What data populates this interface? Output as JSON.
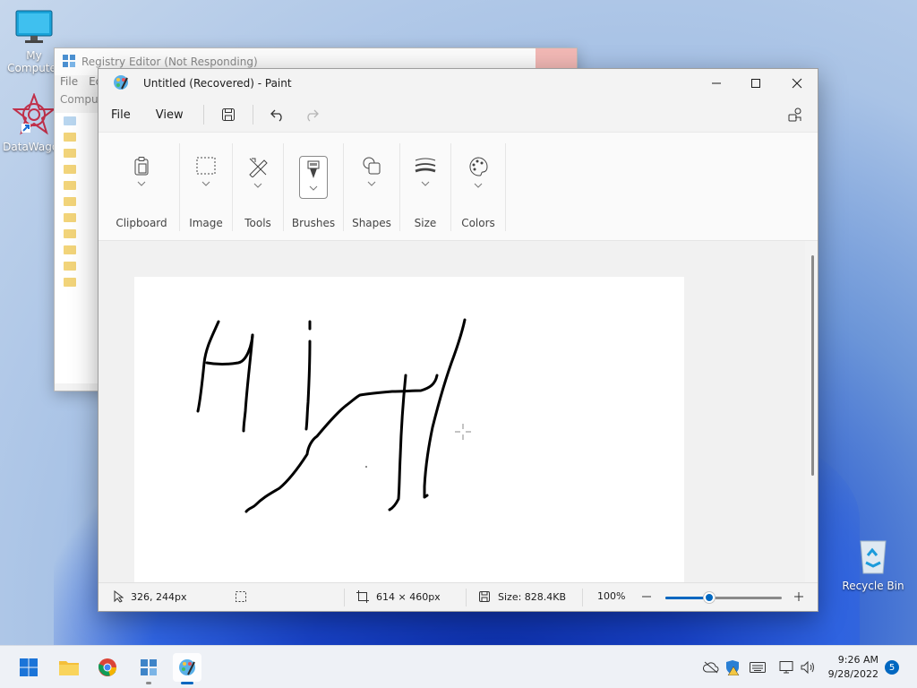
{
  "desktop": {
    "icons": [
      {
        "label": "My Computer",
        "name": "my-computer"
      },
      {
        "label": "DataWagon",
        "name": "datawagon"
      },
      {
        "label": "Recycle Bin",
        "name": "recycle-bin"
      }
    ]
  },
  "regedit": {
    "title": "Registry Editor (Not Responding)",
    "menu": [
      "File",
      "Ed"
    ],
    "address": "Comput"
  },
  "paint": {
    "title": "Untitled (Recovered) - Paint",
    "menu": {
      "file": "File",
      "view": "View"
    },
    "ribbon": {
      "groups": [
        "Clipboard",
        "Image",
        "Tools",
        "Brushes",
        "Shapes",
        "Size",
        "Colors"
      ]
    },
    "status": {
      "cursor_pos": "326, 244px",
      "canvas_size": "614 × 460px",
      "file_size": "Size: 828.4KB",
      "zoom": "100%",
      "zoom_fraction": 0.38
    }
  },
  "taskbar": {
    "time": "9:26 AM",
    "date": "9/28/2022",
    "notifications": "5"
  },
  "colors": {
    "accent": "#0067c0",
    "ink": "#000000"
  }
}
